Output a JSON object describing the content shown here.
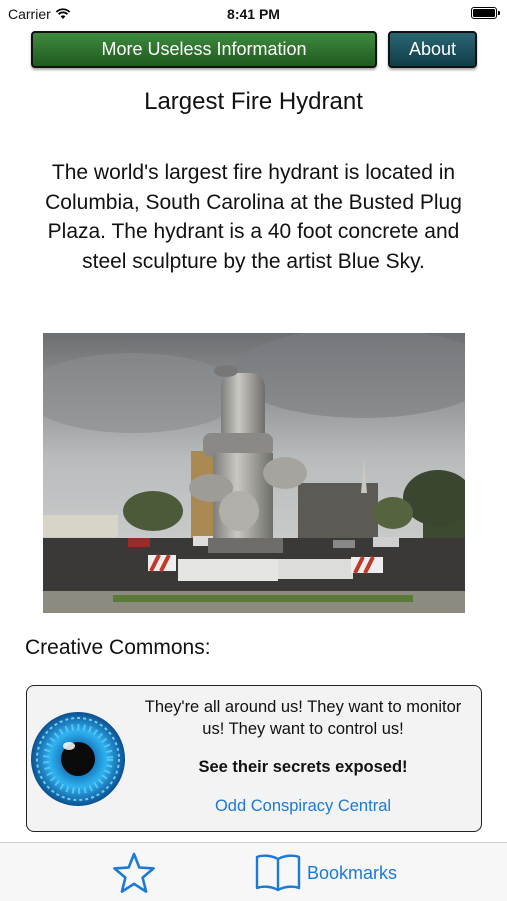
{
  "status_bar": {
    "carrier": "Carrier",
    "time": "8:41 PM",
    "battery_level": 1.0
  },
  "toolbar": {
    "more_label": "More Useless Information",
    "about_label": "About"
  },
  "article": {
    "title": "Largest Fire Hydrant",
    "description": "The world's largest fire hydrant is located in Columbia, South Carolina at the Busted Plug Plaza. The hydrant is a 40 foot concrete and steel sculpture by the artist Blue Sky."
  },
  "credits": {
    "label": "Creative Commons:"
  },
  "ad": {
    "line1": "They're all around us! They want to monitor us! They want to control us!",
    "line2": "See their secrets exposed!",
    "link": "Odd Conspiracy Central"
  },
  "tab_bar": {
    "favorites_icon": "star-icon",
    "bookmarks_icon": "book-icon",
    "bookmarks_label": "Bookmarks",
    "accent_color": "#1a7ad6"
  }
}
